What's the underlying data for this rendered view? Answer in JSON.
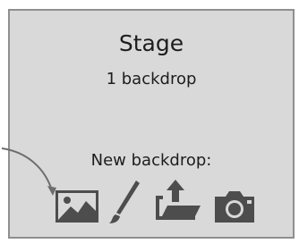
{
  "stage": {
    "title": "Stage",
    "backdrop_count": "1 backdrop"
  },
  "new_backdrop": {
    "label": "New backdrop:",
    "tools": [
      {
        "name": "choose-backdrop-from-library",
        "icon": "landscape-picture-icon"
      },
      {
        "name": "paint-new-backdrop",
        "icon": "paintbrush-icon"
      },
      {
        "name": "upload-backdrop-from-file",
        "icon": "folder-upload-icon"
      },
      {
        "name": "new-backdrop-from-camera",
        "icon": "camera-icon"
      }
    ]
  },
  "colors": {
    "panel_background": "#d9d9d9",
    "panel_border": "#8f8f8f",
    "icon": "#4d4d4d",
    "text": "#1d1d1d",
    "pointer_arrow": "#6e6e6e"
  }
}
